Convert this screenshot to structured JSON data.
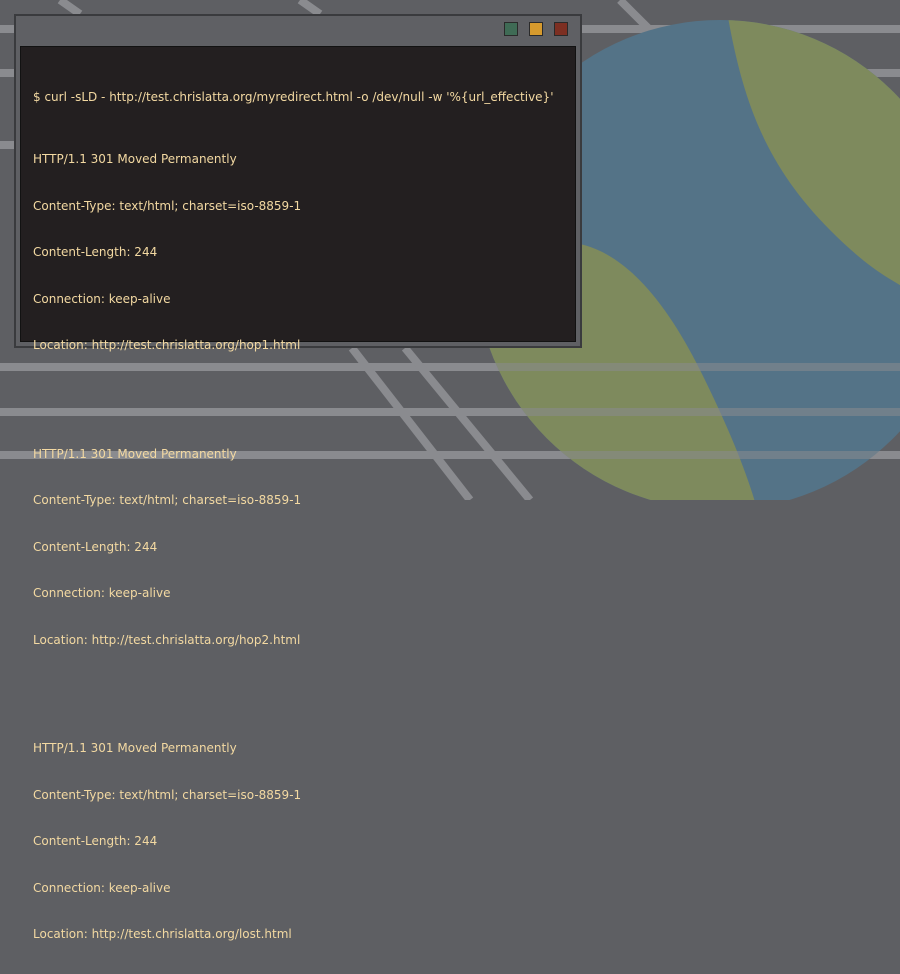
{
  "colors": {
    "background": "#5e5f63",
    "circle_blue": "#547387",
    "circle_green": "#7e8a5d",
    "terminal_bg": "#231f20",
    "terminal_text": "#f3d9a2"
  },
  "window": {
    "buttons": [
      {
        "name": "green-square",
        "color": "#3f6b55"
      },
      {
        "name": "yellow-square",
        "color": "#d69a2d"
      },
      {
        "name": "red-square",
        "color": "#7d2f22"
      }
    ]
  },
  "terminal": {
    "command": "$ curl -sLD - http://test.chrislatta.org/myredirect.html -o /dev/null -w '%{url_effective}'",
    "responses": [
      {
        "status": "HTTP/1.1 301 Moved Permanently",
        "content_type": "Content-Type: text/html; charset=iso-8859-1",
        "content_length": "Content-Length: 244",
        "connection": "Connection: keep-alive",
        "location": "Location: http://test.chrislatta.org/hop1.html"
      },
      {
        "status": "HTTP/1.1 301 Moved Permanently",
        "content_type": "Content-Type: text/html; charset=iso-8859-1",
        "content_length": "Content-Length: 244",
        "connection": "Connection: keep-alive",
        "location": "Location: http://test.chrislatta.org/hop2.html"
      },
      {
        "status": "HTTP/1.1 301 Moved Permanently",
        "content_type": "Content-Type: text/html; charset=iso-8859-1",
        "content_length": "Content-Length: 244",
        "connection": "Connection: keep-alive",
        "location": "Location: http://test.chrislatta.org/lost.html"
      }
    ]
  }
}
